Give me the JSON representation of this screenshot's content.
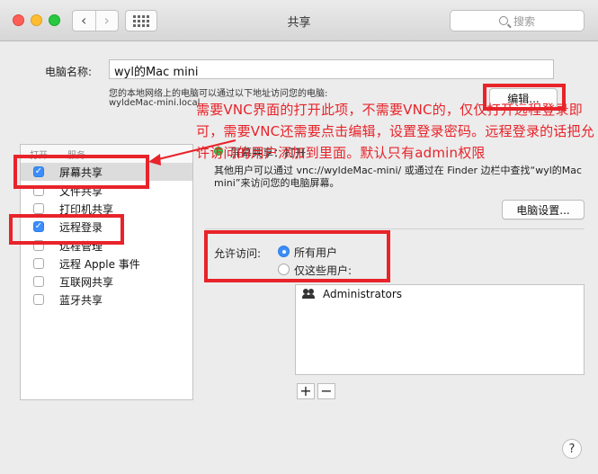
{
  "window": {
    "title": "共享",
    "search_placeholder": "搜索"
  },
  "computer": {
    "name_label": "电脑名称:",
    "name_value": "wyl的Mac mini",
    "local_note": "您的本地网络上的电脑可以通过以下地址访问您的电脑:",
    "local_address": "wyldeMac-mini.local",
    "edit_button": "编辑..."
  },
  "services": {
    "header_on": "打开",
    "header_service": "服务",
    "items": [
      {
        "label": "屏幕共享",
        "checked": true,
        "selected": true
      },
      {
        "label": "文件共享",
        "checked": false
      },
      {
        "label": "打印机共享",
        "checked": false
      },
      {
        "label": "远程登录",
        "checked": true
      },
      {
        "label": "远程管理",
        "checked": false
      },
      {
        "label": "远程 Apple 事件",
        "checked": false
      },
      {
        "label": "互联网共享",
        "checked": false
      },
      {
        "label": "蓝牙共享",
        "checked": false
      }
    ]
  },
  "detail": {
    "status_text": "屏幕共享：打开",
    "description": "其他用户可以通过 vnc://wyldeMac-mini/ 或通过在 Finder 边栏中查找“wyl的Mac mini”来访问您的电脑屏幕。",
    "computer_settings_button": "电脑设置...",
    "access_label": "允许访问:",
    "option_all": "所有用户",
    "option_only": "仅这些用户:",
    "users": [
      "Administrators"
    ],
    "add_button": "+",
    "remove_button": "−",
    "help_button": "?"
  },
  "annotation": {
    "text": "需要VNC界面的打开此项，不需要VNC的，仅仅打开远程登录即可，需要VNC还需要点击编辑，设置登录密码。远程登录的话把允许访问的用户添加到里面。默认只有admin权限"
  },
  "colors": {
    "accent": "#3b8dfb",
    "annotation_red": "#e8232a",
    "status_green": "#34c84a"
  }
}
